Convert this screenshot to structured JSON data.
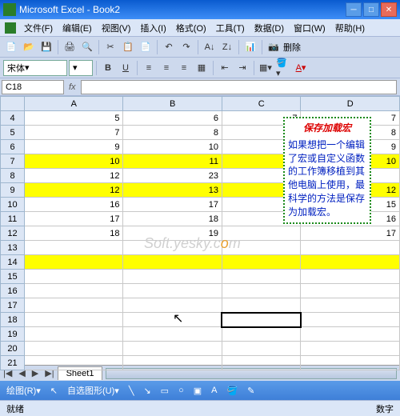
{
  "window": {
    "title": "Microsoft Excel - Book2"
  },
  "menubar": [
    "文件(F)",
    "编辑(E)",
    "视图(V)",
    "插入(I)",
    "格式(O)",
    "工具(T)",
    "数据(D)",
    "窗口(W)",
    "帮助(H)"
  ],
  "toolbar_extra": "删除",
  "formatbar": {
    "font": "宋体",
    "size": ""
  },
  "namebox": "C18",
  "columns": [
    "A",
    "B",
    "C",
    "D"
  ],
  "rows": [
    {
      "n": 4,
      "cells": [
        "5",
        "6",
        "7",
        "7"
      ]
    },
    {
      "n": 5,
      "cells": [
        "7",
        "8",
        "9",
        "8"
      ]
    },
    {
      "n": 6,
      "cells": [
        "9",
        "10",
        "",
        ""
      ],
      "d": "9"
    },
    {
      "n": 7,
      "cells": [
        "10",
        "11",
        "",
        ""
      ],
      "hl": true,
      "d": "10"
    },
    {
      "n": 8,
      "cells": [
        "12",
        "23",
        "",
        ""
      ],
      "d": ""
    },
    {
      "n": 9,
      "cells": [
        "12",
        "13",
        "",
        ""
      ],
      "hl": true,
      "d": "12"
    },
    {
      "n": 10,
      "cells": [
        "16",
        "17",
        "",
        ""
      ],
      "d": "15"
    },
    {
      "n": 11,
      "cells": [
        "17",
        "18",
        "",
        ""
      ],
      "d": "16"
    },
    {
      "n": 12,
      "cells": [
        "18",
        "19",
        "",
        ""
      ],
      "d": "17"
    },
    {
      "n": 13,
      "cells": [
        "",
        "",
        "",
        ""
      ]
    },
    {
      "n": 14,
      "cells": [
        "",
        "",
        "",
        ""
      ],
      "hl": true
    },
    {
      "n": 15,
      "cells": [
        "",
        "",
        "",
        ""
      ]
    },
    {
      "n": 16,
      "cells": [
        "",
        "",
        "",
        ""
      ]
    },
    {
      "n": 17,
      "cells": [
        "",
        "",
        "",
        ""
      ]
    },
    {
      "n": 18,
      "cells": [
        "",
        "",
        "",
        ""
      ],
      "sel": 2
    },
    {
      "n": 19,
      "cells": [
        "",
        "",
        "",
        ""
      ]
    },
    {
      "n": 20,
      "cells": [
        "",
        "",
        "",
        ""
      ]
    },
    {
      "n": 21,
      "cells": [
        "",
        "",
        "",
        ""
      ]
    }
  ],
  "callout": {
    "title": "保存加载宏",
    "body": "如果想把一个编辑了宏或自定义函数的工作簿移植到其他电脑上使用，最科学的方法是保存为加载宏。"
  },
  "watermark": {
    "pre": "Soft.yesky.c",
    "o": "o",
    "post": "m"
  },
  "sheet": {
    "name": "Sheet1",
    "nav": [
      "|◀",
      "◀",
      "▶",
      "▶|"
    ]
  },
  "drawbar": {
    "label1": "绘图(R)▾",
    "label2": "自选图形(U)▾"
  },
  "statusbar": {
    "left": "就绪",
    "right": "数字"
  }
}
